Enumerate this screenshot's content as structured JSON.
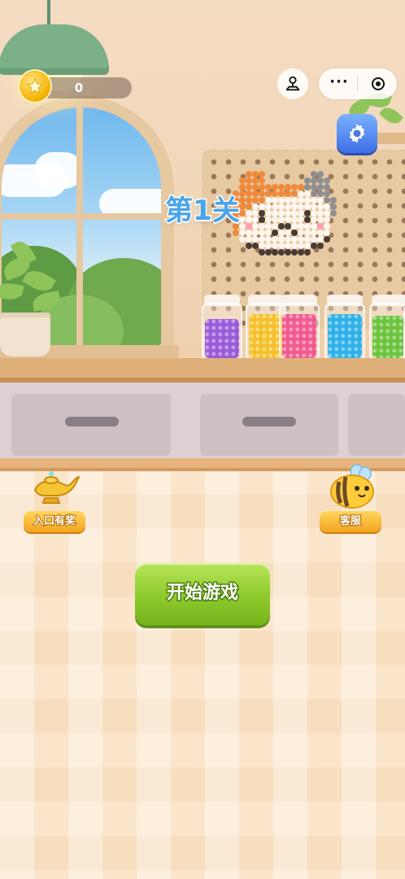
{
  "top_bar": {
    "coins": "0",
    "more_label": "···"
  },
  "level": {
    "label": "第1关"
  },
  "buttons": {
    "left_reward_label": "入口有奖",
    "customer_service_label": "客服",
    "start_label": "开始游戏"
  },
  "icons": {
    "coin": "coin-star-icon",
    "feedback": "joystick-icon",
    "more": "more-dots-icon",
    "close": "mini-program-close-icon",
    "settings": "gear-icon",
    "reward": "magic-lamp-icon",
    "service": "bee-icon"
  },
  "colors": {
    "accent_green": "#8cc92b",
    "level_blue": "#4aa4e8",
    "badge_yellow": "#f3a41e",
    "settings_blue": "#3f6fe6"
  },
  "jars": [
    {
      "color": "#9b5bd9"
    },
    {
      "color": "#f5c12b"
    },
    {
      "color": "#f05a8f"
    },
    {
      "color": "#2fb0e8"
    },
    {
      "color": "#6cc33d"
    }
  ]
}
